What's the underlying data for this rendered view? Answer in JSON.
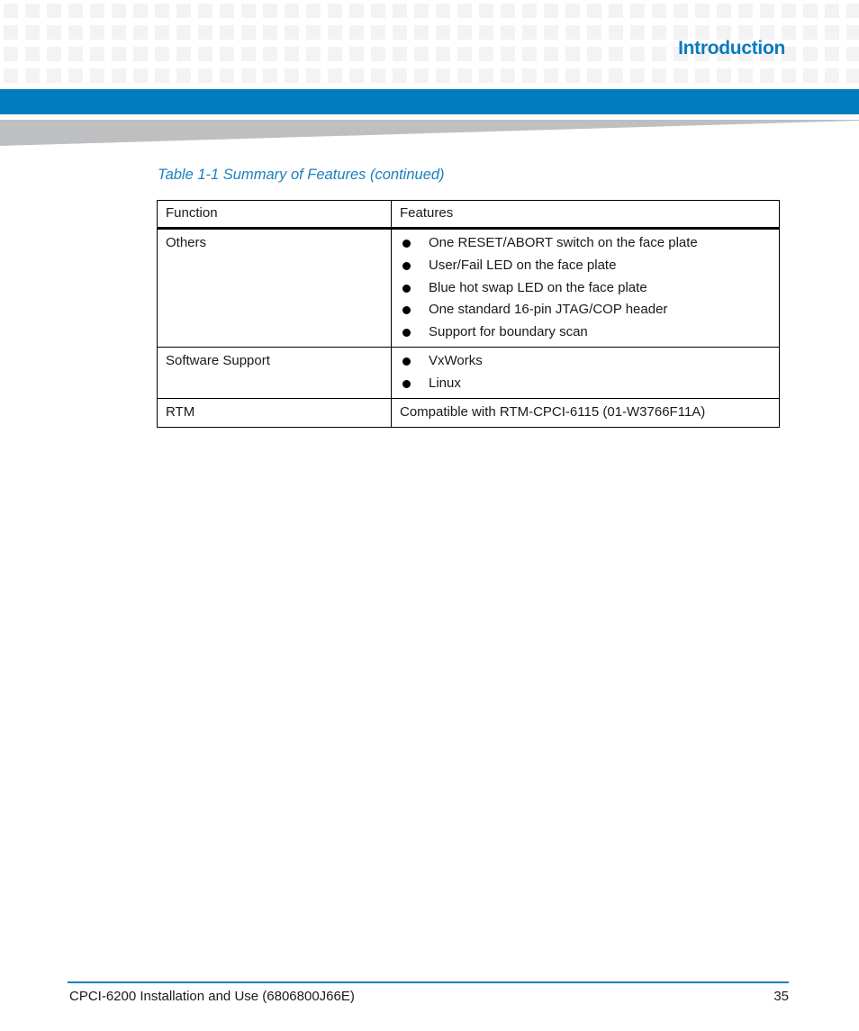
{
  "header": {
    "section_title": "Introduction",
    "brand_color": "#007bbd"
  },
  "table": {
    "caption": "Table 1-1 Summary of Features (continued)",
    "columns": [
      "Function",
      "Features"
    ],
    "rows": [
      {
        "function": "Others",
        "features": [
          "One RESET/ABORT switch on the face plate",
          "User/Fail LED on the face plate",
          "Blue hot swap LED on the face plate",
          "One standard 16-pin JTAG/COP header",
          "Support for boundary scan"
        ]
      },
      {
        "function": "Software Support",
        "features": [
          "VxWorks",
          "Linux"
        ]
      },
      {
        "function": "RTM",
        "text": "Compatible with RTM-CPCI-6115 (01-W3766F11A)"
      }
    ]
  },
  "footer": {
    "document_title": "CPCI-6200 Installation and Use (6806800J66E)",
    "page_number": "35"
  }
}
